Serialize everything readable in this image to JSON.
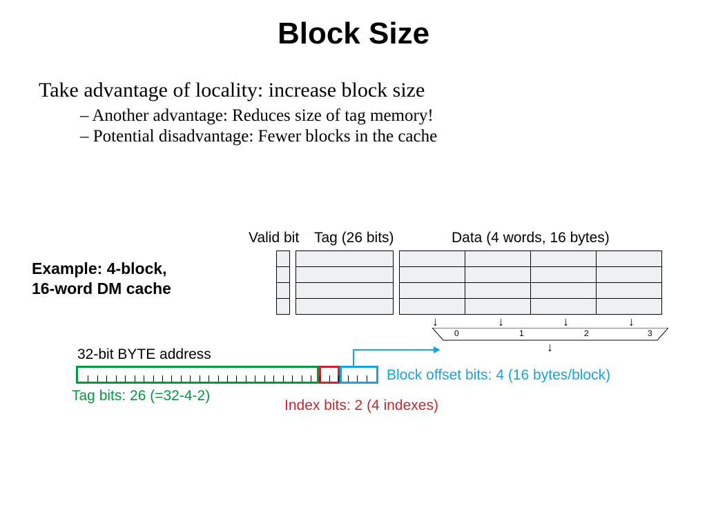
{
  "title": "Block Size",
  "lead": "Take advantage of locality: increase block size",
  "bullets": [
    "Another advantage: Reduces size of tag memory!",
    "Potential disadvantage: Fewer blocks in the cache"
  ],
  "example_l1": "Example: 4-block,",
  "example_l2": "16-word DM cache",
  "headers": {
    "valid": "Valid bit",
    "tag": "Tag (26 bits)",
    "data": "Data (4 words, 16 bytes)"
  },
  "mux": {
    "w0": "0",
    "w1": "1",
    "w2": "2",
    "w3": "3"
  },
  "addr_label": "32-bit BYTE address",
  "captions": {
    "tag": "Tag bits: 26 (=32-4-2)",
    "index": "Index bits: 2 (4 indexes)",
    "offset": "Block offset bits: 4 (16 bytes/block)"
  },
  "chart_data": {
    "type": "table",
    "description": "Direct-mapped cache address breakdown",
    "address_bits": 32,
    "fields": [
      {
        "name": "Tag",
        "bits": 26,
        "color": "#009a3d"
      },
      {
        "name": "Index",
        "bits": 2,
        "color": "#c1272d",
        "indexes": 4
      },
      {
        "name": "Block offset",
        "bits": 4,
        "color": "#19a2d8",
        "block_bytes": 16
      }
    ],
    "cache_lines": 4,
    "words_per_block": 4,
    "valid_bit": true
  }
}
